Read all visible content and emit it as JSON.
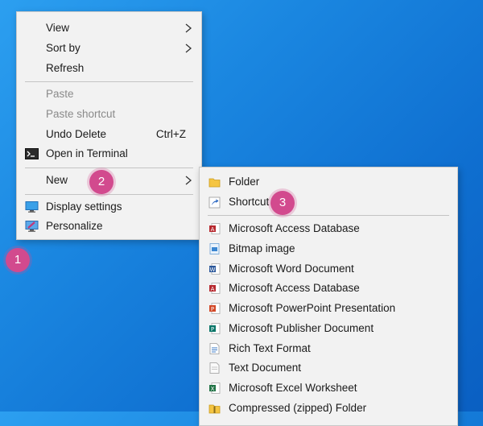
{
  "context_menu": {
    "items": [
      {
        "label": "View"
      },
      {
        "label": "Sort by"
      },
      {
        "label": "Refresh"
      },
      {
        "label": "Paste"
      },
      {
        "label": "Paste shortcut"
      },
      {
        "label": "Undo Delete",
        "shortcut": "Ctrl+Z"
      },
      {
        "label": "Open in Terminal"
      },
      {
        "label": "New"
      },
      {
        "label": "Display settings"
      },
      {
        "label": "Personalize"
      }
    ]
  },
  "new_submenu": {
    "items": [
      {
        "label": "Folder"
      },
      {
        "label": "Shortcut"
      },
      {
        "label": "Microsoft Access Database"
      },
      {
        "label": "Bitmap image"
      },
      {
        "label": "Microsoft Word Document"
      },
      {
        "label": "Microsoft Access Database"
      },
      {
        "label": "Microsoft PowerPoint Presentation"
      },
      {
        "label": "Microsoft Publisher Document"
      },
      {
        "label": "Rich Text Format"
      },
      {
        "label": "Text Document"
      },
      {
        "label": "Microsoft Excel Worksheet"
      },
      {
        "label": "Compressed (zipped) Folder"
      }
    ]
  },
  "callouts": {
    "step1": "1",
    "step2": "2",
    "step3": "3"
  },
  "colors": {
    "desktop": "#1a86e0",
    "menu_bg": "#f2f2f2",
    "callout": "#d24a8e"
  }
}
